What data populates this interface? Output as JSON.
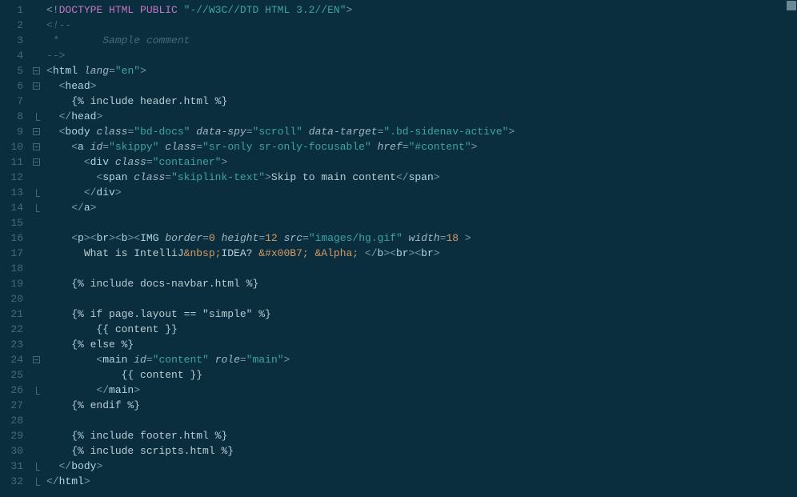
{
  "lines": [
    {
      "n": 1,
      "fold": "",
      "tokens": [
        [
          "pun",
          "<!"
        ],
        [
          "kw",
          "DOCTYPE "
        ],
        [
          "kw",
          "HTML "
        ],
        [
          "kw",
          "PUBLIC "
        ],
        [
          "str",
          "\"-//W3C//DTD HTML 3.2//EN\""
        ],
        [
          "pun",
          ">"
        ]
      ]
    },
    {
      "n": 2,
      "fold": "",
      "tokens": [
        [
          "cmt",
          "<!--"
        ]
      ]
    },
    {
      "n": 3,
      "fold": "",
      "tokens": [
        [
          "cmt",
          " *       Sample comment"
        ]
      ]
    },
    {
      "n": 4,
      "fold": "",
      "tokens": [
        [
          "cmt",
          "-->"
        ]
      ]
    },
    {
      "n": 5,
      "fold": "dash",
      "tokens": [
        [
          "pun",
          "<"
        ],
        [
          "tag",
          "html "
        ],
        [
          "attr",
          "lang"
        ],
        [
          "pun",
          "="
        ],
        [
          "str",
          "\"en\""
        ],
        [
          "pun",
          ">"
        ]
      ]
    },
    {
      "n": 6,
      "fold": "dash",
      "indent": 1,
      "tokens": [
        [
          "pun",
          "<"
        ],
        [
          "tag",
          "head"
        ],
        [
          "pun",
          ">"
        ]
      ]
    },
    {
      "n": 7,
      "fold": "",
      "indent": 2,
      "tokens": [
        [
          "tmpl",
          "{% include header.html %}"
        ]
      ]
    },
    {
      "n": 8,
      "fold": "close",
      "indent": 1,
      "tokens": [
        [
          "pun",
          "</"
        ],
        [
          "tag",
          "head"
        ],
        [
          "pun",
          ">"
        ]
      ]
    },
    {
      "n": 9,
      "fold": "dash",
      "indent": 1,
      "tokens": [
        [
          "pun",
          "<"
        ],
        [
          "tag",
          "body "
        ],
        [
          "attr",
          "class"
        ],
        [
          "pun",
          "="
        ],
        [
          "str",
          "\"bd-docs\""
        ],
        [
          "tag",
          " "
        ],
        [
          "attr",
          "data-spy"
        ],
        [
          "pun",
          "="
        ],
        [
          "str",
          "\"scroll\""
        ],
        [
          "tag",
          " "
        ],
        [
          "attr",
          "data-target"
        ],
        [
          "pun",
          "="
        ],
        [
          "str",
          "\".bd-sidenav-active\""
        ],
        [
          "pun",
          ">"
        ]
      ]
    },
    {
      "n": 10,
      "fold": "dash",
      "indent": 2,
      "tokens": [
        [
          "pun",
          "<"
        ],
        [
          "tag",
          "a "
        ],
        [
          "attr",
          "id"
        ],
        [
          "pun",
          "="
        ],
        [
          "str",
          "\"skippy\""
        ],
        [
          "tag",
          " "
        ],
        [
          "attr",
          "class"
        ],
        [
          "pun",
          "="
        ],
        [
          "str",
          "\"sr-only sr-only-focusable\""
        ],
        [
          "tag",
          " "
        ],
        [
          "attr",
          "href"
        ],
        [
          "pun",
          "="
        ],
        [
          "str",
          "\"#content\""
        ],
        [
          "pun",
          ">"
        ]
      ]
    },
    {
      "n": 11,
      "fold": "dash",
      "indent": 3,
      "tokens": [
        [
          "pun",
          "<"
        ],
        [
          "tag",
          "div "
        ],
        [
          "attr",
          "class"
        ],
        [
          "pun",
          "="
        ],
        [
          "str",
          "\"container\""
        ],
        [
          "pun",
          ">"
        ]
      ]
    },
    {
      "n": 12,
      "fold": "",
      "indent": 4,
      "tokens": [
        [
          "pun",
          "<"
        ],
        [
          "tag",
          "span "
        ],
        [
          "attr",
          "class"
        ],
        [
          "pun",
          "="
        ],
        [
          "str",
          "\"skiplink-text\""
        ],
        [
          "pun",
          ">"
        ],
        [
          "txt",
          "Skip to main content"
        ],
        [
          "pun",
          "</"
        ],
        [
          "tag",
          "span"
        ],
        [
          "pun",
          ">"
        ]
      ]
    },
    {
      "n": 13,
      "fold": "close",
      "indent": 3,
      "tokens": [
        [
          "pun",
          "</"
        ],
        [
          "tag",
          "div"
        ],
        [
          "pun",
          ">"
        ]
      ]
    },
    {
      "n": 14,
      "fold": "close",
      "indent": 2,
      "tokens": [
        [
          "pun",
          "</"
        ],
        [
          "tag",
          "a"
        ],
        [
          "pun",
          ">"
        ]
      ]
    },
    {
      "n": 15,
      "fold": "",
      "indent": 0,
      "tokens": [
        [
          "txt",
          ""
        ]
      ]
    },
    {
      "n": 16,
      "fold": "",
      "indent": 2,
      "tokens": [
        [
          "pun",
          "<"
        ],
        [
          "tag",
          "p"
        ],
        [
          "pun",
          "><"
        ],
        [
          "tag",
          "br"
        ],
        [
          "pun",
          "><"
        ],
        [
          "tag",
          "b"
        ],
        [
          "pun",
          "><"
        ],
        [
          "tag",
          "IMG "
        ],
        [
          "attr",
          "border"
        ],
        [
          "pun",
          "="
        ],
        [
          "num",
          "0"
        ],
        [
          "tag",
          " "
        ],
        [
          "attr",
          "height"
        ],
        [
          "pun",
          "="
        ],
        [
          "num",
          "12"
        ],
        [
          "tag",
          " "
        ],
        [
          "attr",
          "src"
        ],
        [
          "pun",
          "="
        ],
        [
          "str",
          "\"images/hg.gif\""
        ],
        [
          "tag",
          " "
        ],
        [
          "attr",
          "width"
        ],
        [
          "pun",
          "="
        ],
        [
          "num",
          "18"
        ],
        [
          "tag",
          " "
        ],
        [
          "pun",
          ">"
        ]
      ]
    },
    {
      "n": 17,
      "fold": "",
      "indent": 3,
      "tokens": [
        [
          "txt",
          "What is IntelliJ"
        ],
        [
          "ent",
          "&nbsp;"
        ],
        [
          "txt",
          "IDEA? "
        ],
        [
          "ent",
          "&#x00B7;"
        ],
        [
          "txt",
          " "
        ],
        [
          "ent",
          "&Alpha;"
        ],
        [
          "txt",
          " "
        ],
        [
          "pun",
          "</"
        ],
        [
          "tag",
          "b"
        ],
        [
          "pun",
          "><"
        ],
        [
          "tag",
          "br"
        ],
        [
          "pun",
          "><"
        ],
        [
          "tag",
          "br"
        ],
        [
          "pun",
          ">"
        ]
      ]
    },
    {
      "n": 18,
      "fold": "",
      "indent": 0,
      "tokens": [
        [
          "txt",
          ""
        ]
      ]
    },
    {
      "n": 19,
      "fold": "",
      "indent": 2,
      "tokens": [
        [
          "tmpl",
          "{% include docs-navbar.html %}"
        ]
      ]
    },
    {
      "n": 20,
      "fold": "",
      "indent": 0,
      "tokens": [
        [
          "txt",
          ""
        ]
      ]
    },
    {
      "n": 21,
      "fold": "",
      "indent": 2,
      "tokens": [
        [
          "tmpl",
          "{% if page.layout == \"simple\" %}"
        ]
      ]
    },
    {
      "n": 22,
      "fold": "",
      "indent": 4,
      "tokens": [
        [
          "tmpl",
          "{{ content }}"
        ]
      ]
    },
    {
      "n": 23,
      "fold": "",
      "indent": 2,
      "tokens": [
        [
          "tmpl",
          "{% else %}"
        ]
      ]
    },
    {
      "n": 24,
      "fold": "dash",
      "indent": 4,
      "tokens": [
        [
          "pun",
          "<"
        ],
        [
          "tag",
          "main "
        ],
        [
          "attr",
          "id"
        ],
        [
          "pun",
          "="
        ],
        [
          "str",
          "\"content\""
        ],
        [
          "tag",
          " "
        ],
        [
          "attr",
          "role"
        ],
        [
          "pun",
          "="
        ],
        [
          "str",
          "\"main\""
        ],
        [
          "pun",
          ">"
        ]
      ]
    },
    {
      "n": 25,
      "fold": "",
      "indent": 6,
      "tokens": [
        [
          "tmpl",
          "{{ content }}"
        ]
      ]
    },
    {
      "n": 26,
      "fold": "close",
      "indent": 4,
      "tokens": [
        [
          "pun",
          "</"
        ],
        [
          "tag",
          "main"
        ],
        [
          "pun",
          ">"
        ]
      ]
    },
    {
      "n": 27,
      "fold": "",
      "indent": 2,
      "tokens": [
        [
          "tmpl",
          "{% endif %}"
        ]
      ]
    },
    {
      "n": 28,
      "fold": "",
      "indent": 0,
      "tokens": [
        [
          "txt",
          ""
        ]
      ]
    },
    {
      "n": 29,
      "fold": "",
      "indent": 2,
      "tokens": [
        [
          "tmpl",
          "{% include footer.html %}"
        ]
      ]
    },
    {
      "n": 30,
      "fold": "",
      "indent": 2,
      "tokens": [
        [
          "tmpl",
          "{% include scripts.html %}"
        ]
      ]
    },
    {
      "n": 31,
      "fold": "close",
      "indent": 1,
      "tokens": [
        [
          "pun",
          "</"
        ],
        [
          "tag",
          "body"
        ],
        [
          "pun",
          ">"
        ]
      ]
    },
    {
      "n": 32,
      "fold": "close",
      "indent": 0,
      "tokens": [
        [
          "pun",
          "</"
        ],
        [
          "tag",
          "html"
        ],
        [
          "pun",
          ">"
        ]
      ]
    }
  ]
}
